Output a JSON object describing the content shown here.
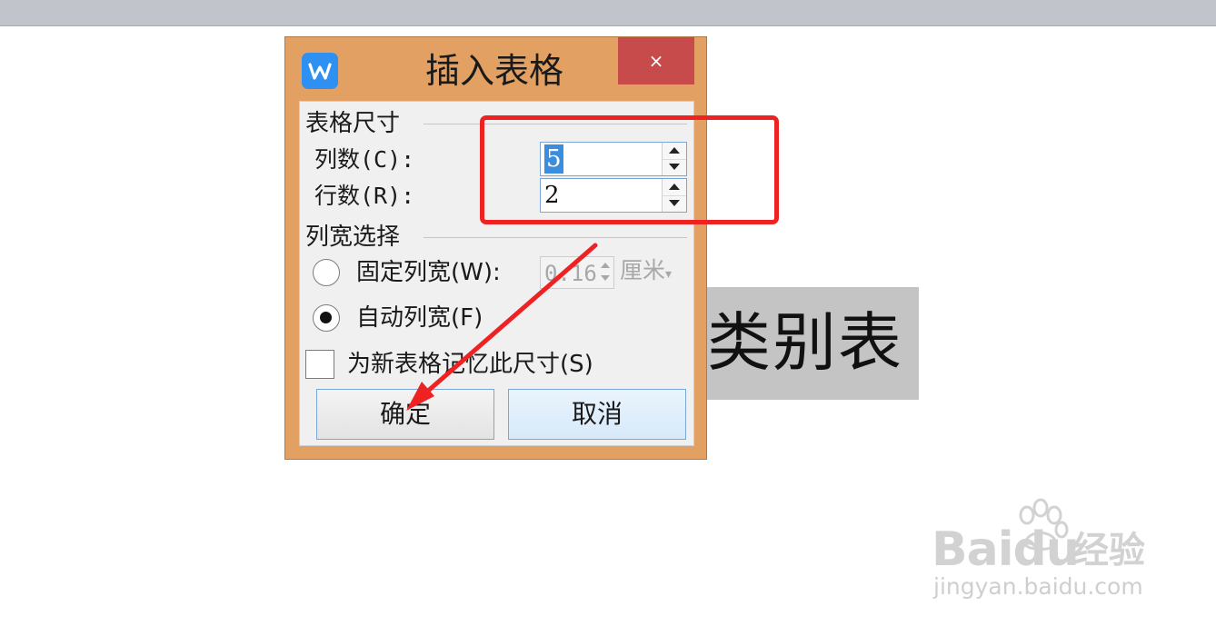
{
  "document": {
    "cell_text": "类别表"
  },
  "dialog": {
    "title": "插入表格",
    "close_label": "×",
    "icon": "wps-writer-icon",
    "size_group": {
      "title": "表格尺寸",
      "columns_label": "列数(C):",
      "columns_value": "5",
      "rows_label": "行数(R):",
      "rows_value": "2"
    },
    "width_group": {
      "title": "列宽选择",
      "fixed_label": "固定列宽(W):",
      "fixed_value": "0.16",
      "unit": "厘米",
      "auto_label": "自动列宽(F)",
      "selected": "auto"
    },
    "remember_label": "为新表格记忆此尺寸(S)",
    "remember_checked": false,
    "ok_label": "确定",
    "cancel_label": "取消"
  },
  "annotation": {
    "color": "#ee2222"
  },
  "watermark": {
    "logo_text": "Baidu",
    "suffix": "经验",
    "url": "jingyan.baidu.com"
  }
}
